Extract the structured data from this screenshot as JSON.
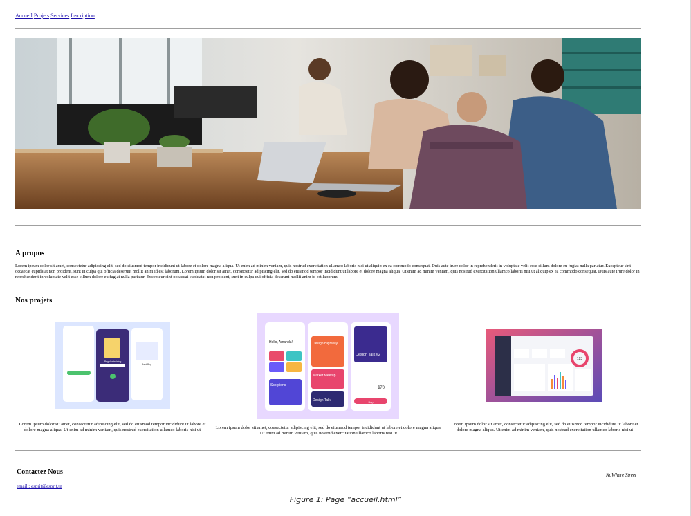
{
  "nav": {
    "links": [
      "Accueil",
      "Projets",
      "Services",
      "Inscription"
    ]
  },
  "about": {
    "title": "A propos",
    "text": "Lorem ipsum dolor sit amet, consectetur adipiscing elit, sed do eiusmod tempor incididunt ut labore et dolore magna aliqua. Ut enim ad minim veniam, quis nostrud exercitation ullamco laboris nisi ut aliquip ex ea commodo consequat. Duis aute irure dolor in reprehenderit in voluptate velit esse cillum dolore eu fugiat nulla pariatur. Excepteur sint occaecat cupidatat non proident, sunt in culpa qui officia deserunt mollit anim id est laborum. Lorem ipsum dolor sit amet, consectetur adipiscing elit, sed do eiusmod tempor incididunt ut labore et dolore magna aliqua. Ut enim ad minim veniam, quis nostrud exercitation ullamco laboris nisi ut aliquip ex ea commodo consequat. Duis aute irure dolor in reprehenderit in voluptate velit esse cillum dolore eu fugiat nulla pariatur. Excepteur sint occaecat cupidatat non proident, sunt in culpa qui officia deserunt mollit anim id est laborum."
  },
  "projects": {
    "title": "Nos projets",
    "items": [
      {
        "caption": "Lorem ipsum dolor sit amet, consectetur adipiscing elit, sed do eiusmod tempor incididunt ut labore et dolore magna aliqua. Ut enim ad minim veniam, quis nostrud exercitation ullamco laboris nisi ut"
      },
      {
        "caption": "Lorem ipsum dolor sit amet, consectetur adipiscing elit, sed do eiusmod tempor incididunt ut labore et dolore magna aliqua. Ut enim ad minim veniam, quis nostrud exercitation ullamco laboris nisi ut"
      },
      {
        "caption": "Lorem ipsum dolor sit amet, consectetur adipiscing elit, sed do eiusmod tempor incididunt ut labore et dolore magna aliqua. Ut enim ad minim veniam, quis nostrud exercitation ullamco laboris nisi ut"
      }
    ],
    "mockups": {
      "p1": {
        "labels": [
          "Regular training",
          "Best Buy"
        ]
      },
      "p2": {
        "labels": [
          "Hello, Amanda!",
          "Design Highway",
          "Design Talk #2",
          "Market Meetup",
          "Scorpions",
          "Design Talk",
          "$70",
          "Buy"
        ]
      },
      "p3": {
        "labels": [
          "123"
        ]
      }
    }
  },
  "contact": {
    "title": "Contactez Nous",
    "email": "email : esprit@esprit.tn",
    "address": "NoWhere Street"
  },
  "caption": "Figure 1: Page “accueil.html”",
  "colors": {
    "link": "#1a0dab",
    "rule": "#a0a0a0",
    "p1_bg": "#dce6ff",
    "p2_bg": "#e8d8ff",
    "p3_grad_start": "#e85a7a",
    "p3_grad_end": "#5b4bb7"
  }
}
